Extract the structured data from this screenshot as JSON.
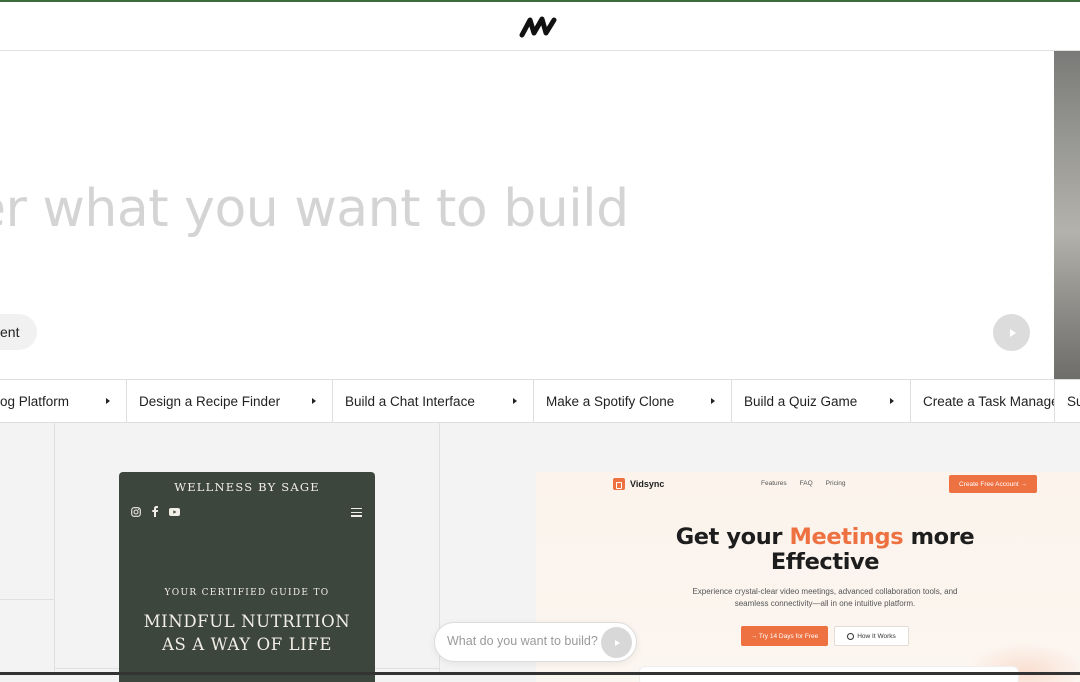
{
  "header": {
    "logo_icon": "wave-logo-icon"
  },
  "hero": {
    "placeholder_text": "er what you want to build",
    "attachment_pill": "ent",
    "submit_icon": "play-arrow-icon"
  },
  "suggestions": [
    {
      "label": "og Platform"
    },
    {
      "label": "Design a Recipe Finder"
    },
    {
      "label": "Build a Chat Interface"
    },
    {
      "label": "Make a Spotify Clone"
    },
    {
      "label": "Build a Quiz Game"
    },
    {
      "label": "Create a Task Manage"
    },
    {
      "label": "Su"
    }
  ],
  "wellness_card": {
    "brand": "WELLNESS BY SAGE",
    "icons": [
      "instagram-icon",
      "facebook-icon",
      "youtube-icon",
      "hamburger-menu-icon"
    ],
    "eyebrow": "YOUR CERTIFIED GUIDE TO",
    "headline_line1": "MINDFUL NUTRITION",
    "headline_line2": "AS A WAY OF LIFE"
  },
  "vidsync_card": {
    "brand": "Vidsync",
    "nav": [
      "Features",
      "FAQ",
      "Pricing"
    ],
    "cta": "Create Free Account →",
    "headline_pre": "Get your ",
    "headline_accent": "Meetings",
    "headline_post": " more",
    "headline_line2": "Effective",
    "subtext_line1": "Experience crystal-clear video meetings, advanced collaboration tools, and",
    "subtext_line2": "seamless connectivity—all in one intuitive platform.",
    "primary_button": "→ Try 14 Days for Free",
    "secondary_button": "How It Works",
    "accent_color": "#ee7142"
  },
  "prompt_bar": {
    "placeholder": "What do you want to build?",
    "send_icon": "send-arrow-icon"
  },
  "colors": {
    "wellness_bg": "#3d463c",
    "vidsync_accent": "#ee7142"
  }
}
